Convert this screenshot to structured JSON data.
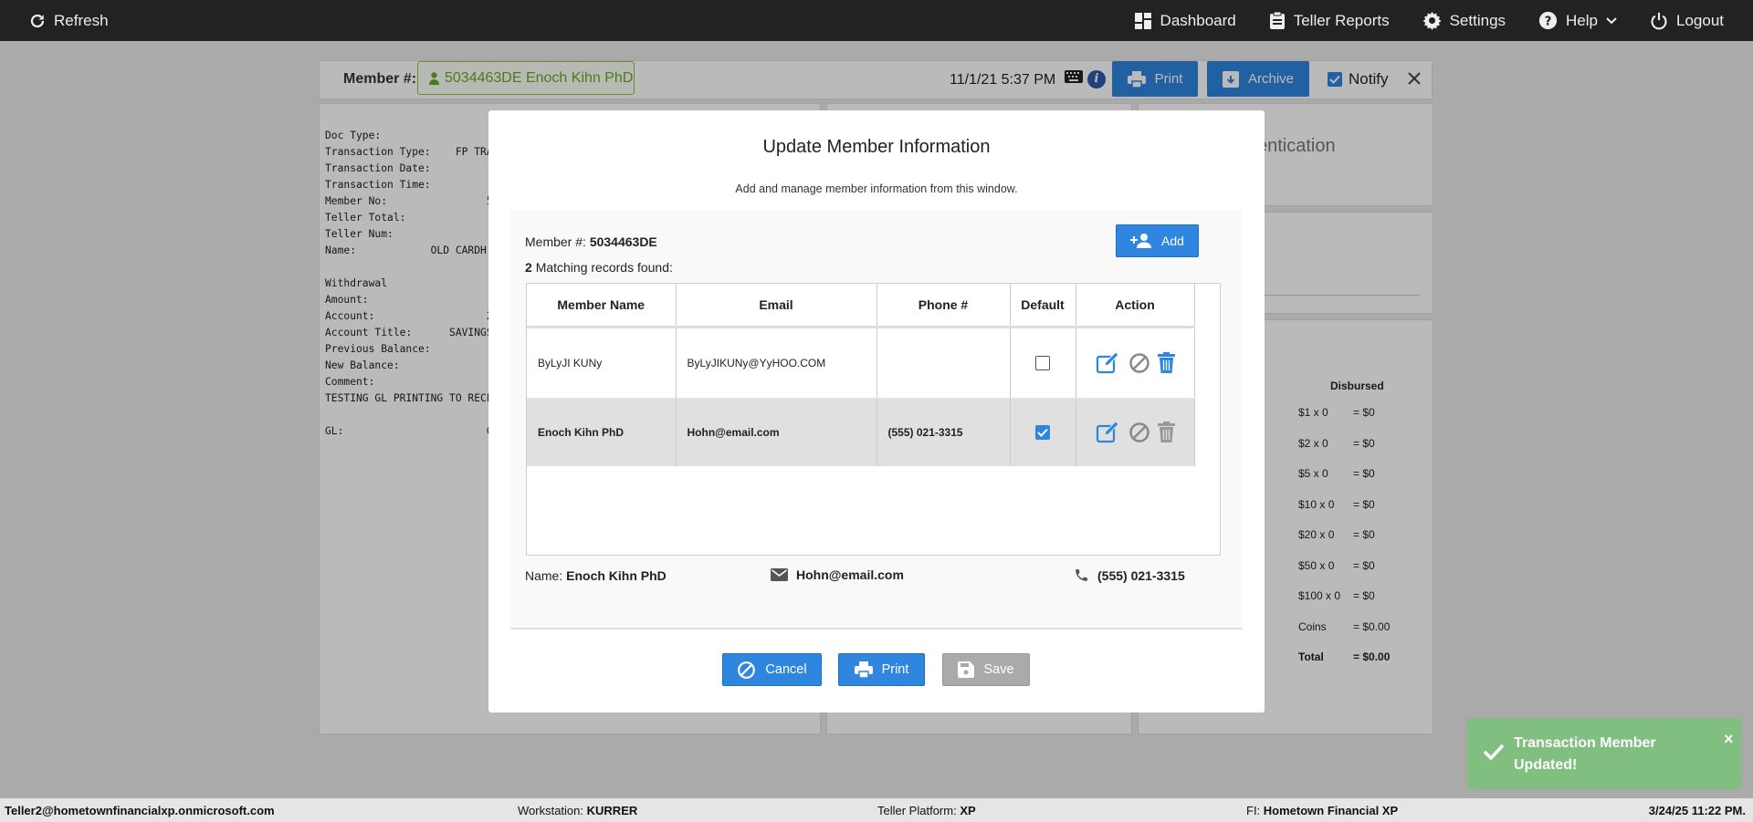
{
  "topbar": {
    "refresh": "Refresh",
    "dashboard": "Dashboard",
    "teller_reports": "Teller Reports",
    "settings": "Settings",
    "help": "Help",
    "logout": "Logout"
  },
  "memberbar": {
    "label": "Member #:",
    "member": "5034463DE Enoch Kihn PhD",
    "datetime": "11/1/21 5:37 PM",
    "print": "Print",
    "archive": "Archive",
    "notify": "Notify"
  },
  "receipt": {
    "text": "Doc Type:\nTransaction Type:    FP TRA\nTransaction Date:\nTransaction Time:\nMember No:                5\nTeller Total:\nTeller Num:\nName:            OLD CARDH\n\nWithdrawal\nAmount:\nAccount:                  2\nAccount Title:      SAVINGS\nPrevious Balance:\nNew Balance:\nComment:\nTESTING GL PRINTING TO RECE\n\nGL:                       0"
  },
  "auth": {
    "text": "entication"
  },
  "disbursed": {
    "header": "Disbursed",
    "rows": [
      {
        "label": "$1 x 0",
        "value": "= $0"
      },
      {
        "label": "$2 x 0",
        "value": "= $0"
      },
      {
        "label": "$5 x 0",
        "value": "= $0"
      },
      {
        "label": "$10 x 0",
        "value": "= $0"
      },
      {
        "label": "$20 x 0",
        "value": "= $0"
      },
      {
        "label": "$50 x 0",
        "value": "= $0"
      },
      {
        "label": "$100 x 0",
        "value": "= $0"
      },
      {
        "label": "Coins",
        "value": "= $0.00"
      },
      {
        "label": "Total",
        "value": "= $0.00"
      }
    ]
  },
  "modal": {
    "title": "Update Member Information",
    "subtitle": "Add and manage member information from this window.",
    "member_label": "Member #:",
    "member_no": "5034463DE",
    "match_count": "2",
    "match_text": "Matching records found:",
    "add": "Add",
    "columns": [
      "Member Name",
      "Email",
      "Phone #",
      "Default",
      "Action"
    ],
    "rows": [
      {
        "name": "ByLyJI KUNy",
        "email": "ByLyJIKUNy@YyHOO.COM",
        "phone": "",
        "default": false
      },
      {
        "name": "Enoch Kihn PhD",
        "email": "Hohn@email.com",
        "phone": "(555) 021-3315",
        "default": true
      }
    ],
    "summary": {
      "name_label": "Name:",
      "name": "Enoch Kihn PhD",
      "email": "Hohn@email.com",
      "phone": "(555) 021-3315"
    },
    "cancel": "Cancel",
    "print": "Print",
    "save": "Save"
  },
  "toast": {
    "message": "Transaction Member Updated!",
    "close": "×"
  },
  "statusbar": {
    "user": "Teller2@hometownfinancialxp.onmicrosoft.com",
    "workstation_label": "Workstation:",
    "workstation": "KURRER",
    "platform_label": "Teller Platform:",
    "platform": "XP",
    "fi_label": "FI:",
    "fi": "Hometown Financial XP",
    "datetime": "3/24/25 11:22 PM."
  },
  "colors": {
    "topbar": "#222222",
    "primary": "#2e86de",
    "member_green": "#6aa82a",
    "toast": "#81bf81",
    "selected_row": "#e0e0e0"
  }
}
